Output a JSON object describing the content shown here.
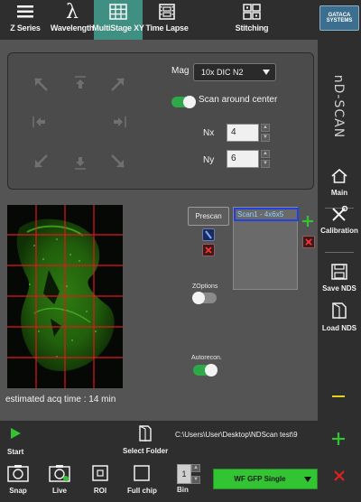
{
  "tabs": [
    {
      "label": "Z Series",
      "icon": "hamburger-icon"
    },
    {
      "label": "Wavelength",
      "icon": "lambda-icon"
    },
    {
      "label": "MultiStage XY",
      "icon": "grid-icon",
      "active": true
    },
    {
      "label": "Time Lapse",
      "icon": "film-icon"
    },
    {
      "label": "Stitching",
      "icon": "stitch-icon"
    }
  ],
  "tab_lambda_glyph": "λ",
  "logo_text": "GATACA SYSTEMS",
  "side_title": "nD-SCAN",
  "side_buttons": {
    "main": "Main",
    "calibration": "Calibration",
    "save": "Save NDS",
    "load": "Load NDS"
  },
  "stage": {
    "mag_label": "Mag",
    "mag_value": "10x DIC N2",
    "scan_around_center": "Scan around center",
    "scan_around_center_on": true,
    "nx_label": "Nx",
    "nx_value": "4",
    "ny_label": "Ny",
    "ny_value": "6"
  },
  "prescan_label": "Prescan",
  "scan_list": [
    "Scan1 - 4x6x5"
  ],
  "zoptions_label": "ZOptions",
  "zoptions_on": false,
  "autorecon_label": "Autorecon.",
  "autorecon_on": true,
  "acq_time": "estimated acq time : 14 min",
  "bottom": {
    "start": "Start",
    "select_folder": "Select Folder",
    "path": "C:\\Users\\User\\Desktop\\NDScan test\\9",
    "snap": "Snap",
    "live": "Live",
    "roi": "ROI",
    "full_chip": "Full chip",
    "bin_label": "Bin",
    "bin_value": "1",
    "channel": "WF GFP Single"
  },
  "colors": {
    "accent_tab": "#3f8f82",
    "green": "#2fa84a",
    "red": "#e02020",
    "channel_green": "#33c433"
  }
}
